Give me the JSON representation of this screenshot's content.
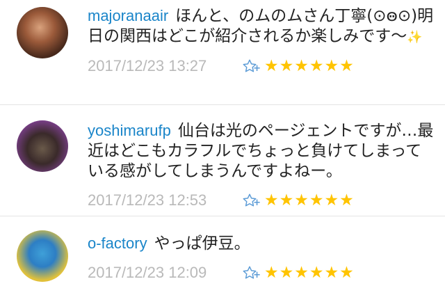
{
  "comments": [
    {
      "username": "majoranaair",
      "text": "ほんと、のムのムさん丁寧(⊙ꙫ⊙)明日の関西はどこが紹介されるか楽しみです〜",
      "emoji": "✨",
      "date": "2017/12/23 13:27",
      "stars": [
        "★",
        "★",
        "★",
        "★",
        "★",
        "★"
      ]
    },
    {
      "username": "yoshimarufp",
      "text": "仙台は光のページェントですが…最近はどこもカラフルでちょっと負けてしまっている感がしてしまうんですよねー。",
      "date": "2017/12/23 12:53",
      "stars": [
        "★",
        "★",
        "★",
        "★",
        "★",
        "★"
      ]
    },
    {
      "username": "o-factory",
      "text": "やっぱ伊豆。",
      "date": "2017/12/23 12:09",
      "stars": [
        "★",
        "★",
        "★",
        "★",
        "★",
        "★"
      ]
    }
  ],
  "icons": {
    "favorite_add": "star-outline-plus",
    "star": "filled-star"
  },
  "colors": {
    "username": "#1a85c9",
    "date": "#b9b9b9",
    "star": "#ffc400",
    "favorite_icon": "#5b9bd6"
  }
}
